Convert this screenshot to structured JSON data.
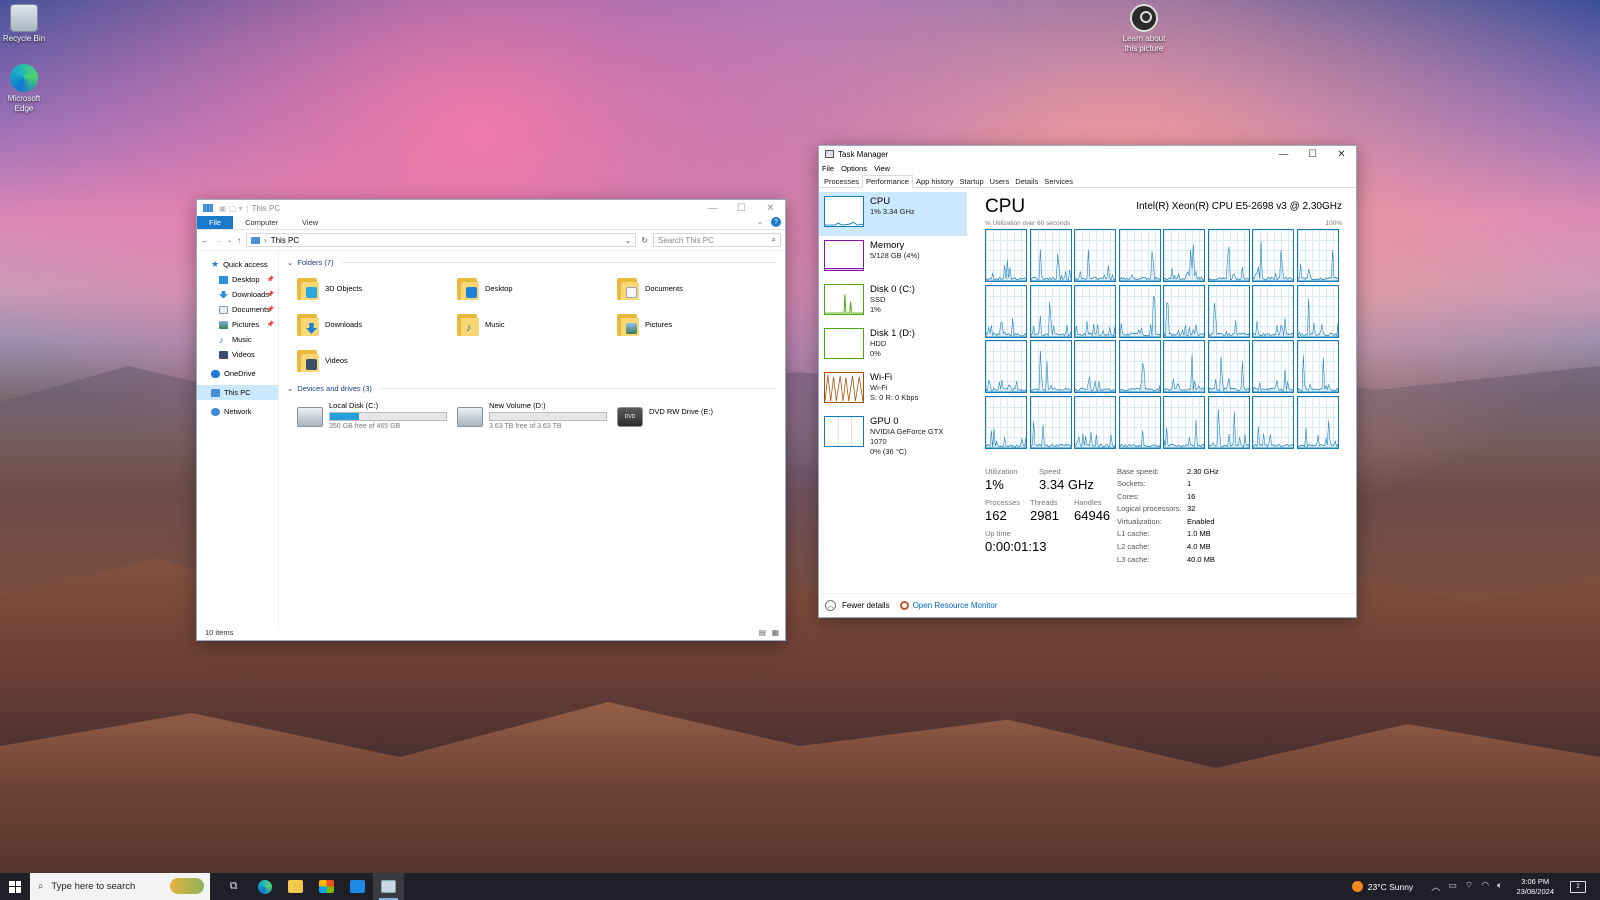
{
  "desktop": {
    "icons": [
      {
        "label": "Recycle Bin"
      },
      {
        "label": "Microsoft Edge"
      },
      {
        "label": "Learn about this picture"
      }
    ]
  },
  "explorer": {
    "title": "This PC",
    "ribbon_tabs": [
      "File",
      "Computer",
      "View"
    ],
    "address": "This PC",
    "search_placeholder": "Search This PC",
    "nav": {
      "quick_access": "Quick access",
      "items": [
        "Desktop",
        "Downloads",
        "Documents",
        "Pictures",
        "Music",
        "Videos"
      ],
      "onedrive": "OneDrive",
      "this_pc": "This PC",
      "network": "Network"
    },
    "folders_header": "Folders (7)",
    "folders": [
      "3D Objects",
      "Desktop",
      "Documents",
      "Downloads",
      "Music",
      "Pictures",
      "Videos"
    ],
    "drives_header": "Devices and drives (3)",
    "drives": [
      {
        "name": "Local Disk (C:)",
        "free": "350 GB free of 465 GB",
        "used_fraction": 0.247
      },
      {
        "name": "New Volume (D:)",
        "free": "3.63 TB free of 3.63 TB",
        "used_fraction": 0.0
      },
      {
        "name": "DVD RW Drive (E:)",
        "glyph_text": "DVD"
      }
    ],
    "status": "10 items"
  },
  "taskmgr": {
    "title": "Task Manager",
    "menu": [
      "File",
      "Options",
      "View"
    ],
    "tabs": [
      "Processes",
      "Performance",
      "App history",
      "Startup",
      "Users",
      "Details",
      "Services"
    ],
    "active_tab": "Performance",
    "resources": [
      {
        "name": "CPU",
        "sub1": "1% 3.34 GHz",
        "sub2": "",
        "color": "#117dbb"
      },
      {
        "name": "Memory",
        "sub1": "5/128 GB (4%)",
        "sub2": "",
        "color": "#8b12ae"
      },
      {
        "name": "Disk 0 (C:)",
        "sub1": "SSD",
        "sub2": "1%",
        "color": "#4da60c"
      },
      {
        "name": "Disk 1 (D:)",
        "sub1": "HDD",
        "sub2": "0%",
        "color": "#4da60c"
      },
      {
        "name": "Wi-Fi",
        "sub1": "Wi-Fi",
        "sub2": "S: 0 R: 0 Kbps",
        "color": "#a74f01"
      },
      {
        "name": "GPU 0",
        "sub1": "NVIDIA GeForce GTX 1070",
        "sub2": "0% (36 °C)",
        "color": "#117dbb"
      }
    ],
    "cpu": {
      "heading": "CPU",
      "model": "Intel(R) Xeon(R) CPU E5-2698 v3 @ 2.30GHz",
      "util_label": "% Utilization over 60 seconds",
      "util_max": "100%",
      "core_count": 32,
      "utilization_label": "Utilization",
      "utilization": "1%",
      "speed_label": "Speed",
      "speed": "3.34 GHz",
      "processes_label": "Processes",
      "processes": "162",
      "threads_label": "Threads",
      "threads": "2981",
      "handles_label": "Handles",
      "handles": "64946",
      "uptime_label": "Up time",
      "uptime": "0:00:01:13",
      "details": [
        {
          "k": "Base speed:",
          "v": "2.30 GHz"
        },
        {
          "k": "Sockets:",
          "v": "1"
        },
        {
          "k": "Cores:",
          "v": "16"
        },
        {
          "k": "Logical processors:",
          "v": "32"
        },
        {
          "k": "Virtualization:",
          "v": "Enabled"
        },
        {
          "k": "L1 cache:",
          "v": "1.0 MB"
        },
        {
          "k": "L2 cache:",
          "v": "4.0 MB"
        },
        {
          "k": "L3 cache:",
          "v": "40.0 MB"
        }
      ]
    },
    "fewer_details": "Fewer details",
    "resource_monitor": "Open Resource Monitor"
  },
  "taskbar": {
    "search_placeholder": "Type here to search",
    "weather": "23°C  Sunny",
    "time": "3:06 PM",
    "date": "23/08/2024",
    "notif_count": "2"
  }
}
